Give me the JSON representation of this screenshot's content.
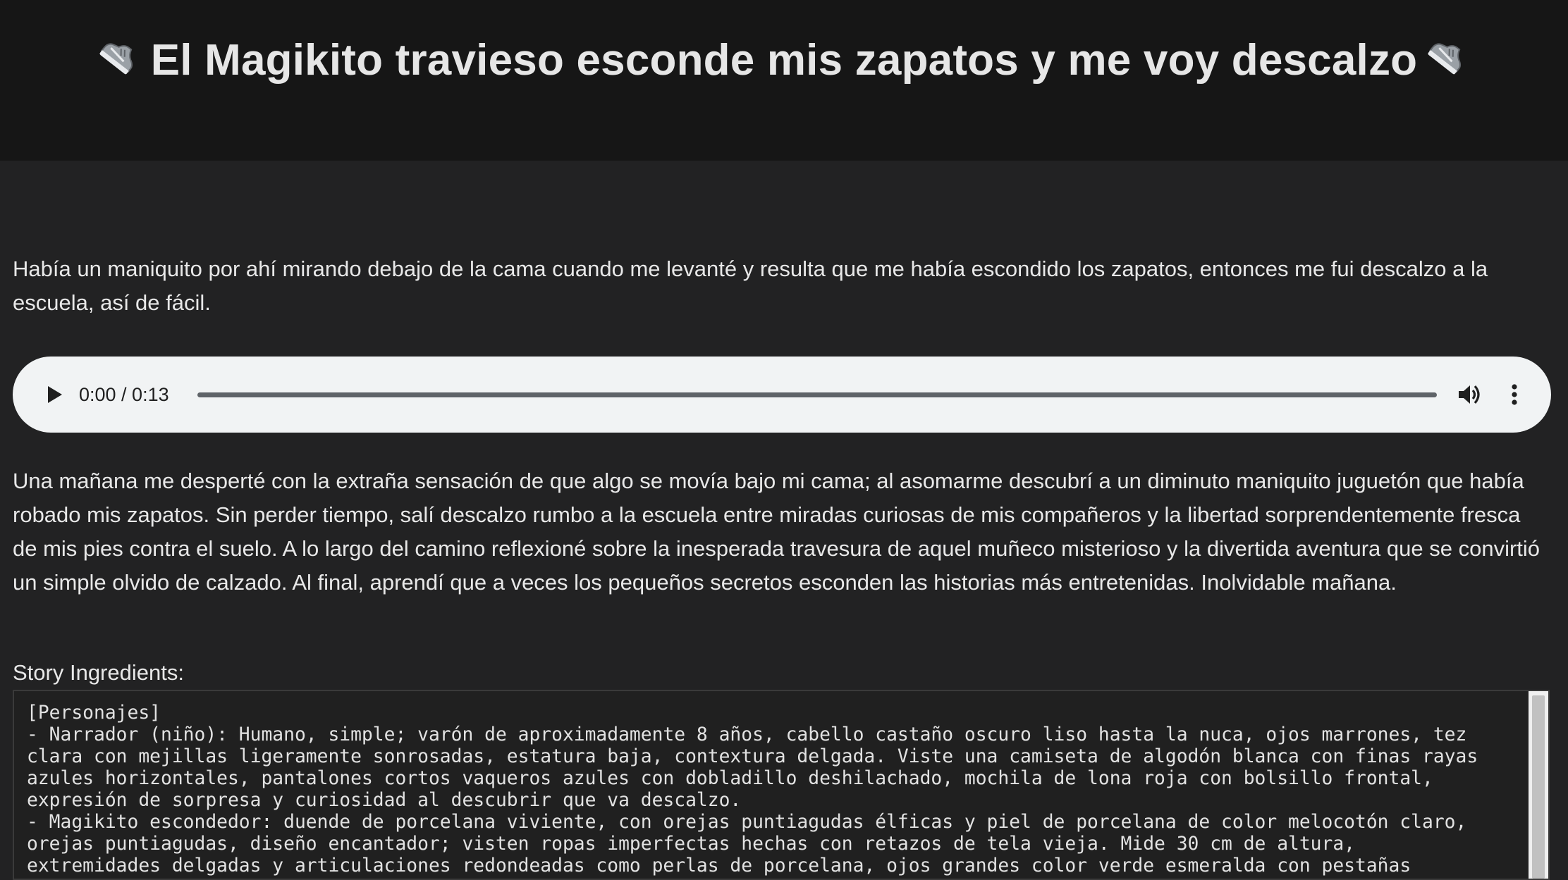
{
  "header": {
    "title": "El Magikito travieso esconde mis zapatos y me voy descalzo",
    "title_icon": "sneaker-emoji"
  },
  "intro": {
    "text": "Había un maniquito por ahí mirando debajo de la cama cuando me levanté y resulta que me había escondido los zapatos, entonces me fui descalzo a la escuela, así de fácil."
  },
  "audio": {
    "time_display": "0:00 / 0:13",
    "progress": 0,
    "icons": [
      "play-icon",
      "volume-icon",
      "more-options-icon"
    ]
  },
  "story": {
    "text": "Una mañana me desperté con la extraña sensación de que algo se movía bajo mi cama; al asomarme descubrí a un diminuto maniquito juguetón que había robado mis zapatos. Sin perder tiempo, salí descalzo rumbo a la escuela entre miradas curiosas de mis compañeros y la libertad sorprendentemente fresca de mis pies contra el suelo. A lo largo del camino reflexioné sobre la inesperada travesura de aquel muñeco misterioso y la divertida aventura que se convirtió un simple olvido de calzado. Al final, aprendí que a veces los pequeños secretos esconden las historias más entretenidas. Inolvidable mañana."
  },
  "ingredients": {
    "label": "Story Ingredients:",
    "text": "[Personajes]\n- Narrador (niño): Humano, simple; varón de aproximadamente 8 años, cabello castaño oscuro liso hasta la nuca, ojos marrones, tez\nclara con mejillas ligeramente sonrosadas, estatura baja, contextura delgada. Viste una camiseta de algodón blanca con finas rayas\nazules horizontales, pantalones cortos vaqueros azules con dobladillo deshilachado, mochila de lona roja con bolsillo frontal,\nexpresión de sorpresa y curiosidad al descubrir que va descalzo.\n- Magikito escondedor: duende de porcelana viviente, con orejas puntiagudas élficas y piel de porcelana de color melocotón claro,\norejas puntiagudas, diseño encantador; visten ropas imperfectas hechas con retazos de tela vieja. Mide 30 cm de altura,\nextremidades delgadas y articulaciones redondeadas como perlas de porcelana, ojos grandes color verde esmeralda con pestañas"
  },
  "colors": {
    "page_bg": "#222223",
    "header_bg": "#161616",
    "player_bg": "#f1f3f4",
    "text": "#e8e8e8"
  }
}
